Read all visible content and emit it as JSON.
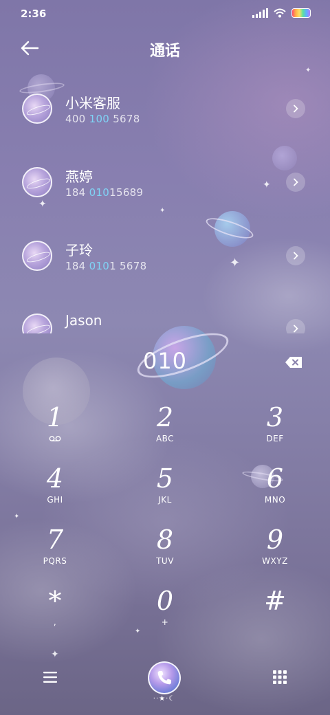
{
  "status_bar": {
    "time": "2:36"
  },
  "header": {
    "title": "通话"
  },
  "contacts": [
    {
      "name": "小米客服",
      "number_segments": [
        {
          "text": "400 ",
          "highlight": false
        },
        {
          "text": "100",
          "highlight": true
        },
        {
          "text": " 5678",
          "highlight": false
        }
      ]
    },
    {
      "name": "燕婷",
      "number_segments": [
        {
          "text": "184 ",
          "highlight": false
        },
        {
          "text": "010",
          "highlight": true
        },
        {
          "text": "15689",
          "highlight": false
        }
      ]
    },
    {
      "name": "子玲",
      "number_segments": [
        {
          "text": "184 ",
          "highlight": false
        },
        {
          "text": "010",
          "highlight": true
        },
        {
          "text": "1 5678",
          "highlight": false
        }
      ]
    },
    {
      "name": "Jason",
      "number_segments": []
    }
  ],
  "dialer": {
    "dialed_number": "010"
  },
  "keypad": {
    "keys": [
      {
        "digit": "1",
        "letters": ""
      },
      {
        "digit": "2",
        "letters": "ABC"
      },
      {
        "digit": "3",
        "letters": "DEF"
      },
      {
        "digit": "4",
        "letters": "GHI"
      },
      {
        "digit": "5",
        "letters": "JKL"
      },
      {
        "digit": "6",
        "letters": "MNO"
      },
      {
        "digit": "7",
        "letters": "PQRS"
      },
      {
        "digit": "8",
        "letters": "TUV"
      },
      {
        "digit": "9",
        "letters": "WXYZ"
      },
      {
        "digit": "*",
        "letters": ","
      },
      {
        "digit": "0",
        "letters": "+"
      },
      {
        "digit": "#",
        "letters": ""
      }
    ]
  },
  "bottom_bar": {
    "call_decoration": "··★·☾"
  },
  "colors": {
    "highlight": "#7fd3f5",
    "text": "#ffffff"
  },
  "icons": [
    "signal-icon",
    "wifi-icon",
    "battery-icon",
    "back-arrow-icon",
    "chevron-right-icon",
    "backspace-icon",
    "voicemail-icon",
    "menu-icon",
    "phone-icon",
    "keypad-icon"
  ]
}
